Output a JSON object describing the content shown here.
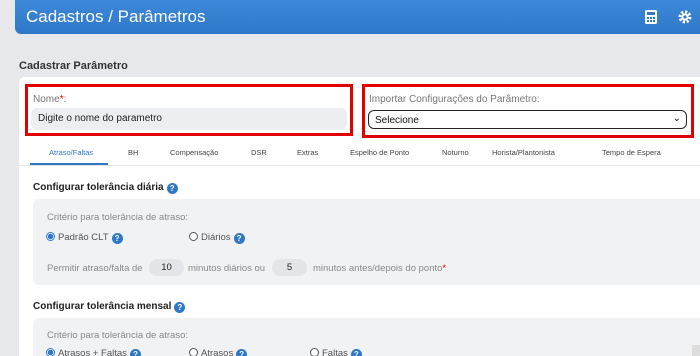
{
  "header": {
    "title": "Cadastros / Parâmetros",
    "icons": [
      "calculator-icon",
      "gear-icon"
    ]
  },
  "form": {
    "section_title": "Cadastrar Parâmetro",
    "name": {
      "label": "Nome",
      "required_mark": "*",
      "colon": ":",
      "value": "Digite o nome do parametro"
    },
    "import": {
      "label": "Importar Configurações do Parâmetro:",
      "selected": "Selecione"
    }
  },
  "tabs": [
    "Atraso/Faltas",
    "BH",
    "Compensação",
    "DSR",
    "Extras",
    "Espelho de Ponto",
    "Noturno",
    "Horista/Plantonista",
    "Tempo de Espera"
  ],
  "daily": {
    "title": "Configurar tolerância diária",
    "criteria_label": "Critério para tolerância de atraso:",
    "options": [
      "Padrão CLT",
      "Diários"
    ],
    "permit_prefix": "Permitir atraso/falta de",
    "minutes_daily": "10",
    "daily_suffix": "minutos diários ou",
    "minutes_before": "5",
    "before_suffix": "minutos antes/depois do ponto",
    "required_mark": "*"
  },
  "monthly": {
    "title": "Configurar tolerância mensal",
    "criteria_label": "Critério para tolerância de atraso:",
    "options": [
      "Atrasos + Faltas",
      "Atrasos",
      "Faltas"
    ]
  },
  "colors": {
    "accent": "#2f78c8",
    "highlight": "#e00000"
  }
}
